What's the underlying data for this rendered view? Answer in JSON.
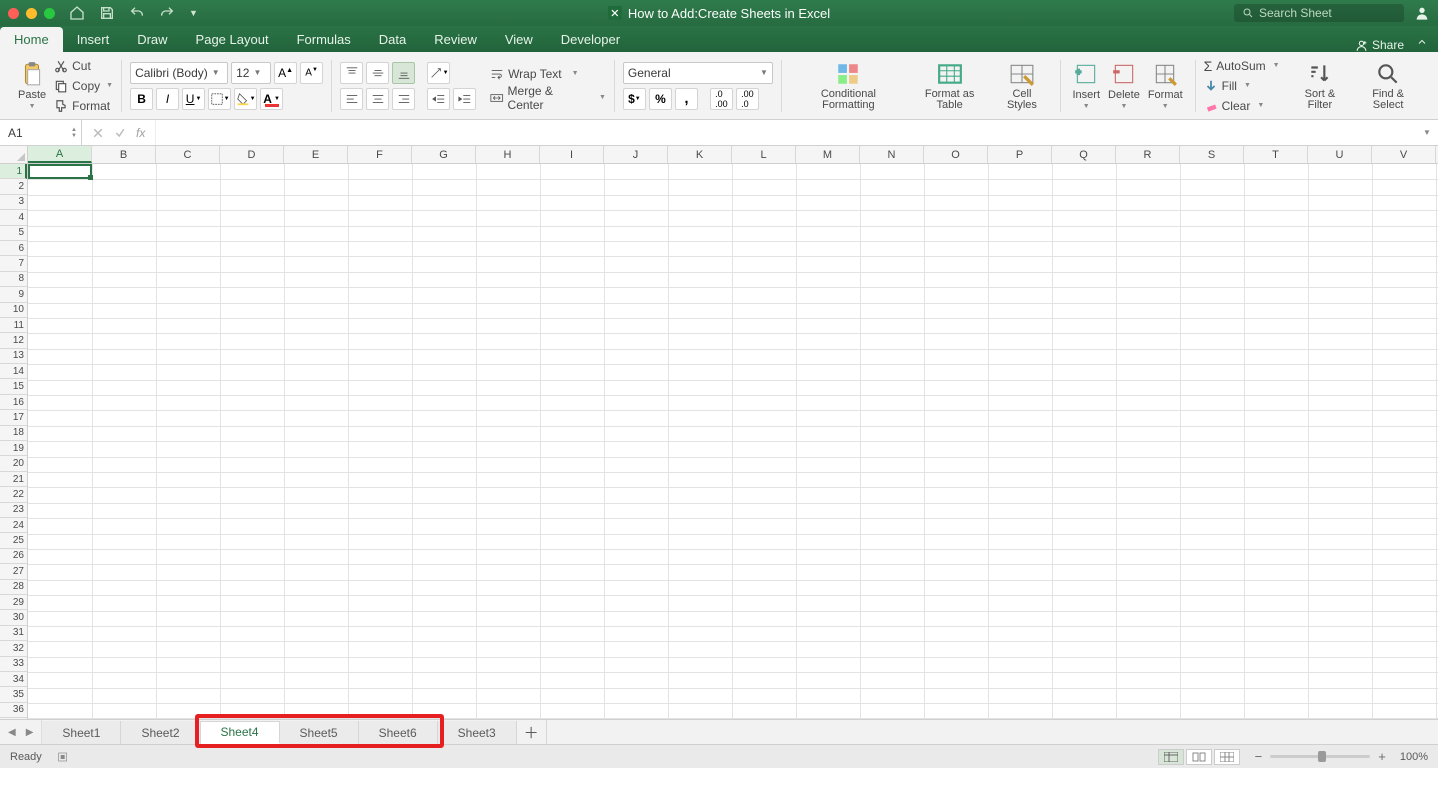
{
  "title": "How to Add:Create Sheets in Excel",
  "search_placeholder": "Search Sheet",
  "share_label": "Share",
  "tabs": [
    "Home",
    "Insert",
    "Draw",
    "Page Layout",
    "Formulas",
    "Data",
    "Review",
    "View",
    "Developer"
  ],
  "active_tab": "Home",
  "clipboard": {
    "paste": "Paste",
    "cut": "Cut",
    "copy": "Copy",
    "format": "Format"
  },
  "font": {
    "name": "Calibri (Body)",
    "size": "12"
  },
  "alignment": {
    "wrap": "Wrap Text",
    "merge": "Merge & Center"
  },
  "number_format": "General",
  "styles": {
    "cond": "Conditional Formatting",
    "table": "Format as Table",
    "cell": "Cell Styles"
  },
  "cells_group": {
    "insert": "Insert",
    "delete": "Delete",
    "format": "Format"
  },
  "editing": {
    "autosum": "AutoSum",
    "fill": "Fill",
    "clear": "Clear",
    "sort": "Sort & Filter",
    "find": "Find & Select"
  },
  "name_box": "A1",
  "columns": [
    "A",
    "B",
    "C",
    "D",
    "E",
    "F",
    "G",
    "H",
    "I",
    "J",
    "K",
    "L",
    "M",
    "N",
    "O",
    "P",
    "Q",
    "R",
    "S",
    "T",
    "U",
    "V"
  ],
  "active_column": "A",
  "row_count": 36,
  "active_row": 1,
  "sheets": [
    "Sheet1",
    "Sheet2",
    "Sheet4",
    "Sheet5",
    "Sheet6",
    "Sheet3"
  ],
  "active_sheet": "Sheet4",
  "annotated_sheets": [
    "Sheet4",
    "Sheet5",
    "Sheet6"
  ],
  "status": "Ready",
  "zoom": "100%"
}
